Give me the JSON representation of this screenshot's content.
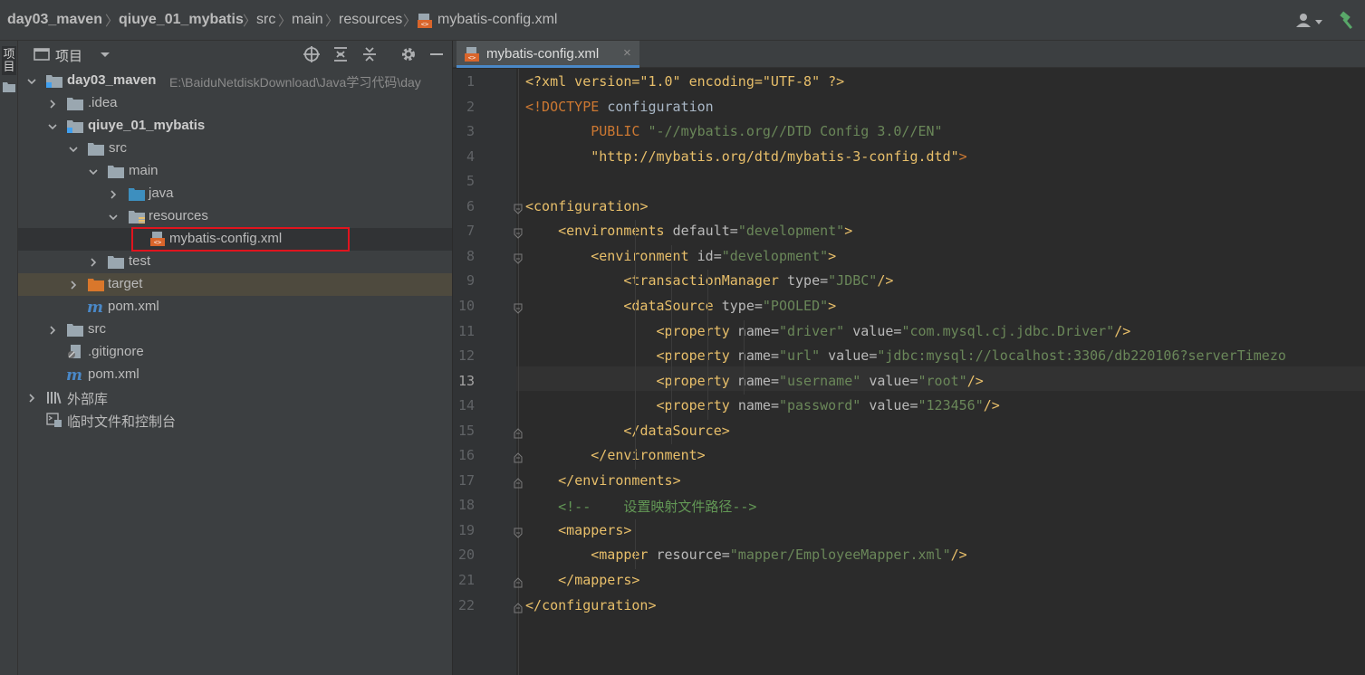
{
  "breadcrumb": {
    "items": [
      "day03_maven",
      "qiuye_01_mybatis",
      "src",
      "main",
      "resources",
      "mybatis-config.xml"
    ]
  },
  "side_strip": {
    "label": "项目"
  },
  "project_panel": {
    "title": "项目",
    "tree": [
      {
        "label": "day03_maven",
        "path": "E:\\BaiduNetdiskDownload\\Java学习代码\\day",
        "bold": true
      },
      {
        "label": ".idea"
      },
      {
        "label": "qiuye_01_mybatis",
        "bold": true
      },
      {
        "label": "src"
      },
      {
        "label": "main"
      },
      {
        "label": "java"
      },
      {
        "label": "resources"
      },
      {
        "label": "mybatis-config.xml"
      },
      {
        "label": "test"
      },
      {
        "label": "target"
      },
      {
        "label": "pom.xml"
      },
      {
        "label": "src"
      },
      {
        "label": ".gitignore"
      },
      {
        "label": "pom.xml"
      },
      {
        "label": "外部库"
      },
      {
        "label": "临时文件和控制台"
      }
    ]
  },
  "editor": {
    "tab": {
      "label": "mybatis-config.xml",
      "close": "×"
    },
    "current_line": 13,
    "lines": [
      [
        [
          "t-pi",
          "<?xml version=\"1.0\" encoding=\"UTF-8\" ?>"
        ]
      ],
      [
        [
          "t-doct",
          "<!DOCTYPE "
        ],
        [
          "t-text",
          "configuration"
        ]
      ],
      [
        [
          "t-text",
          "        "
        ],
        [
          "t-doct",
          "PUBLIC "
        ],
        [
          "t-str",
          "\"-//mybatis.org//DTD Config 3.0//EN\""
        ]
      ],
      [
        [
          "t-text",
          "        "
        ],
        [
          "t-strv",
          "\"http://mybatis.org/dtd/mybatis-3-config.dtd\""
        ],
        [
          "t-doct",
          ">"
        ]
      ],
      [
        [
          "t-text",
          ""
        ]
      ],
      [
        [
          "t-brk",
          "<"
        ],
        [
          "t-tagn",
          "configuration"
        ],
        [
          "t-brk",
          ">"
        ]
      ],
      [
        [
          "t-text",
          "    "
        ],
        [
          "t-brk",
          "<"
        ],
        [
          "t-tagn",
          "environments "
        ],
        [
          "t-attr",
          "default"
        ],
        [
          "t-eq",
          "="
        ],
        [
          "t-val",
          "\"development\""
        ],
        [
          "t-brk",
          ">"
        ]
      ],
      [
        [
          "t-text",
          "        "
        ],
        [
          "t-brk",
          "<"
        ],
        [
          "t-tagn",
          "environment "
        ],
        [
          "t-attr",
          "id"
        ],
        [
          "t-eq",
          "="
        ],
        [
          "t-val",
          "\"development\""
        ],
        [
          "t-brk",
          ">"
        ]
      ],
      [
        [
          "t-text",
          "            "
        ],
        [
          "t-brk",
          "<"
        ],
        [
          "t-tagn",
          "transactionManager "
        ],
        [
          "t-attr",
          "type"
        ],
        [
          "t-eq",
          "="
        ],
        [
          "t-val",
          "\"JDBC\""
        ],
        [
          "t-brk",
          "/>"
        ]
      ],
      [
        [
          "t-text",
          "            "
        ],
        [
          "t-brk",
          "<"
        ],
        [
          "t-tagn",
          "dataSource "
        ],
        [
          "t-attr",
          "type"
        ],
        [
          "t-eq",
          "="
        ],
        [
          "t-val",
          "\"POOLED\""
        ],
        [
          "t-brk",
          ">"
        ]
      ],
      [
        [
          "t-text",
          "                "
        ],
        [
          "t-brk",
          "<"
        ],
        [
          "t-tagn",
          "property "
        ],
        [
          "t-attr",
          "name"
        ],
        [
          "t-eq",
          "="
        ],
        [
          "t-val",
          "\"driver\" "
        ],
        [
          "t-attr",
          "value"
        ],
        [
          "t-eq",
          "="
        ],
        [
          "t-val",
          "\"com.mysql.cj.jdbc.Driver\""
        ],
        [
          "t-brk",
          "/>"
        ]
      ],
      [
        [
          "t-text",
          "                "
        ],
        [
          "t-brk",
          "<"
        ],
        [
          "t-tagn",
          "property "
        ],
        [
          "t-attr",
          "name"
        ],
        [
          "t-eq",
          "="
        ],
        [
          "t-val",
          "\"url\" "
        ],
        [
          "t-attr",
          "value"
        ],
        [
          "t-eq",
          "="
        ],
        [
          "t-val",
          "\"jdbc:mysql://localhost:3306/db220106?serverTimezo"
        ]
      ],
      [
        [
          "t-text",
          "                "
        ],
        [
          "t-brk",
          "<"
        ],
        [
          "t-tagn",
          "property "
        ],
        [
          "t-attr",
          "name"
        ],
        [
          "t-eq",
          "="
        ],
        [
          "t-val",
          "\"username\" "
        ],
        [
          "t-attr",
          "value"
        ],
        [
          "t-eq",
          "="
        ],
        [
          "t-val",
          "\"root\""
        ],
        [
          "t-brk",
          "/>"
        ]
      ],
      [
        [
          "t-text",
          "                "
        ],
        [
          "t-brk",
          "<"
        ],
        [
          "t-tagn",
          "property "
        ],
        [
          "t-attr",
          "name"
        ],
        [
          "t-eq",
          "="
        ],
        [
          "t-val",
          "\"password\" "
        ],
        [
          "t-attr",
          "value"
        ],
        [
          "t-eq",
          "="
        ],
        [
          "t-val",
          "\"123456\""
        ],
        [
          "t-brk",
          "/>"
        ]
      ],
      [
        [
          "t-text",
          "            "
        ],
        [
          "t-brk",
          "</"
        ],
        [
          "t-tagn",
          "dataSource"
        ],
        [
          "t-brk",
          ">"
        ]
      ],
      [
        [
          "t-text",
          "        "
        ],
        [
          "t-brk",
          "</"
        ],
        [
          "t-tagn",
          "environment"
        ],
        [
          "t-brk",
          ">"
        ]
      ],
      [
        [
          "t-text",
          "    "
        ],
        [
          "t-brk",
          "</"
        ],
        [
          "t-tagn",
          "environments"
        ],
        [
          "t-brk",
          ">"
        ]
      ],
      [
        [
          "t-text",
          "    "
        ],
        [
          "t-cmt",
          "<!--    设置映射文件路径-->"
        ]
      ],
      [
        [
          "t-text",
          "    "
        ],
        [
          "t-brk",
          "<"
        ],
        [
          "t-tagn",
          "mappers"
        ],
        [
          "t-brk",
          ">"
        ]
      ],
      [
        [
          "t-text",
          "        "
        ],
        [
          "t-brk",
          "<"
        ],
        [
          "t-tagn",
          "mapper "
        ],
        [
          "t-attr",
          "resource"
        ],
        [
          "t-eq",
          "="
        ],
        [
          "t-val",
          "\"mapper/EmployeeMapper.xml\""
        ],
        [
          "t-brk",
          "/>"
        ]
      ],
      [
        [
          "t-text",
          "    "
        ],
        [
          "t-brk",
          "</"
        ],
        [
          "t-tagn",
          "mappers"
        ],
        [
          "t-brk",
          ">"
        ]
      ],
      [
        [
          "t-brk",
          "</"
        ],
        [
          "t-tagn",
          "configuration"
        ],
        [
          "t-brk",
          ">"
        ]
      ]
    ]
  }
}
